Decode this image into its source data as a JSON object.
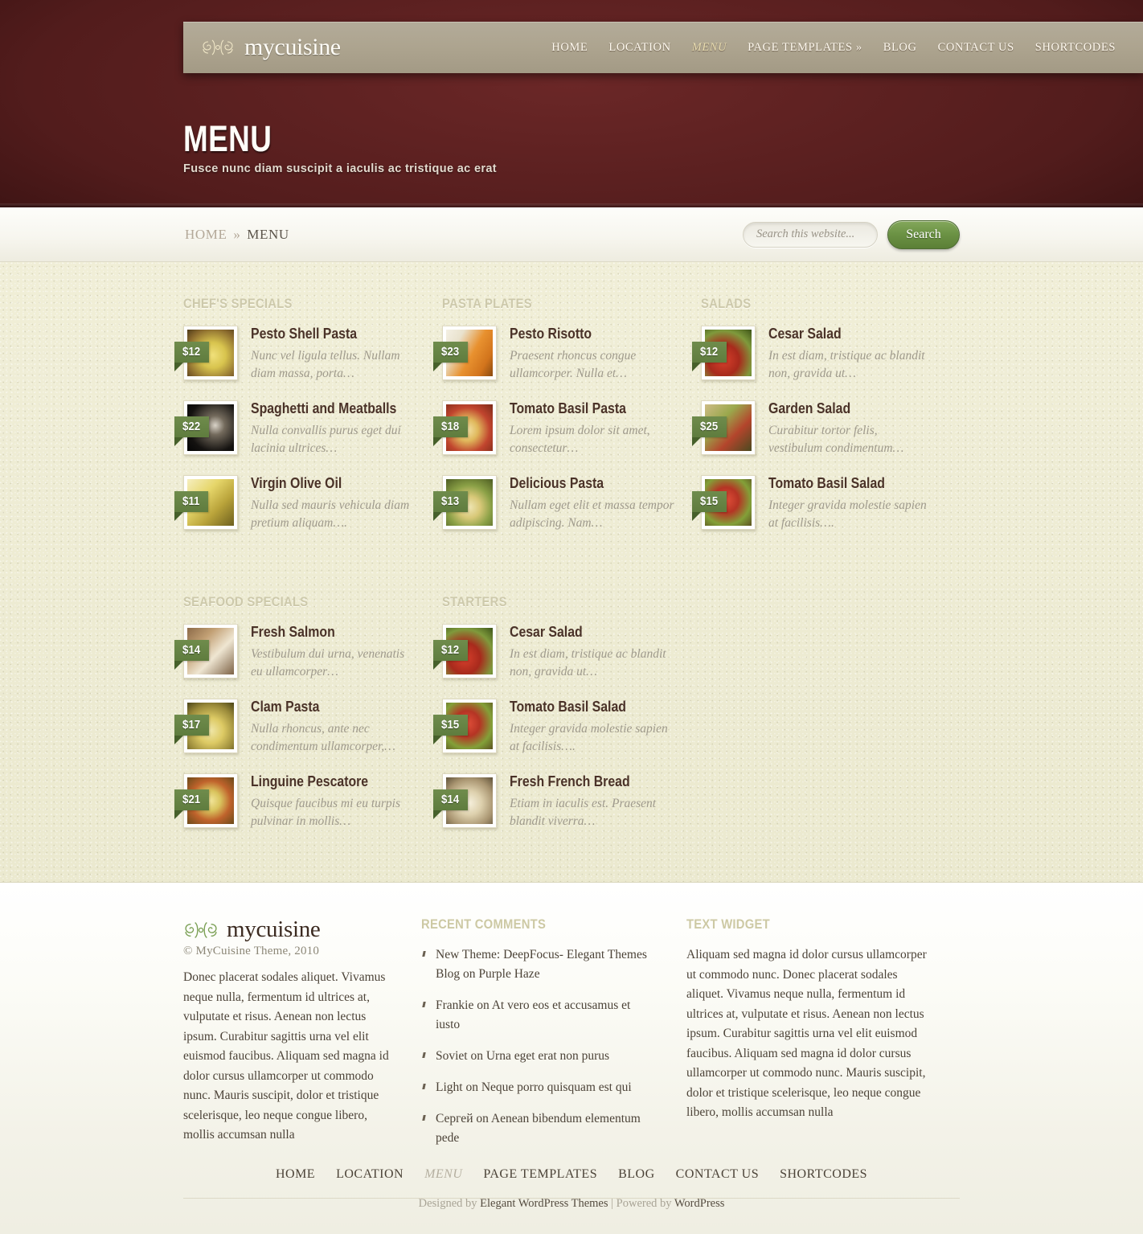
{
  "brand": {
    "name": "mycuisine",
    "flourish_icon": "ornamental-flourish-icon"
  },
  "nav": {
    "items": [
      {
        "label": "HOME",
        "active": false
      },
      {
        "label": "LOCATION",
        "active": false
      },
      {
        "label": "MENU",
        "active": true
      },
      {
        "label": "PAGE TEMPLATES »",
        "active": false
      },
      {
        "label": "BLOG",
        "active": false
      },
      {
        "label": "CONTACT US",
        "active": false
      },
      {
        "label": "SHORTCODES",
        "active": false
      }
    ]
  },
  "hero": {
    "title": "MENU",
    "subtitle": "Fusce nunc diam suscipit a iaculis ac tristique ac erat"
  },
  "breadcrumb": {
    "home": "HOME",
    "separator": "»",
    "current": "MENU"
  },
  "search": {
    "placeholder": "Search this website...",
    "value": "",
    "button": "Search"
  },
  "menu_sections": [
    {
      "title": "CHEF'S SPECIALS",
      "items": [
        {
          "price": "$12",
          "name": "Pesto Shell Pasta",
          "desc": "Nunc vel ligula tellus. Nullam diam massa, porta…",
          "photo": "ph-pestoshell"
        },
        {
          "price": "$22",
          "name": "Spaghetti and Meatballs",
          "desc": "Nulla convallis purus eget dui lacinia ultrices…",
          "photo": "ph-spaghetti"
        },
        {
          "price": "$11",
          "name": "Virgin Olive Oil",
          "desc": "Nulla sed mauris vehicula diam pretium aliquam….",
          "photo": "ph-oliveoil"
        }
      ]
    },
    {
      "title": "PASTA PLATES",
      "items": [
        {
          "price": "$23",
          "name": "Pesto Risotto",
          "desc": "Praesent rhoncus congue ullamcorper. Nulla et…",
          "photo": "ph-risotto"
        },
        {
          "price": "$18",
          "name": "Tomato Basil Pasta",
          "desc": "Lorem ipsum dolor sit amet, consectetur…",
          "photo": "ph-tomatopasta"
        },
        {
          "price": "$13",
          "name": "Delicious Pasta",
          "desc": "Nullam eget elit et massa tempor adipiscing. Nam…",
          "photo": "ph-delicious"
        }
      ]
    },
    {
      "title": "SALADS",
      "items": [
        {
          "price": "$12",
          "name": "Cesar Salad",
          "desc": "In est diam, tristique ac blandit non, gravida ut…",
          "photo": "ph-cesar"
        },
        {
          "price": "$25",
          "name": "Garden Salad",
          "desc": "Curabitur tortor felis, vestibulum condimentum…",
          "photo": "ph-garden"
        },
        {
          "price": "$15",
          "name": "Tomato Basil Salad",
          "desc": "Integer gravida molestie sapien at facilisis….",
          "photo": "ph-tomatobasil"
        }
      ]
    },
    {
      "title": "SEAFOOD SPECIALS",
      "items": [
        {
          "price": "$14",
          "name": "Fresh Salmon",
          "desc": "Vestibulum dui urna, venenatis eu ullamcorper…",
          "photo": "ph-salmon"
        },
        {
          "price": "$17",
          "name": "Clam Pasta",
          "desc": "Nulla rhoncus, ante nec condimentum ullamcorper,…",
          "photo": "ph-clam"
        },
        {
          "price": "$21",
          "name": "Linguine Pescatore",
          "desc": "Quisque faucibus mi eu turpis pulvinar in mollis…",
          "photo": "ph-linguine"
        }
      ]
    },
    {
      "title": "STARTERS",
      "items": [
        {
          "price": "$12",
          "name": "Cesar Salad",
          "desc": "In est diam, tristique ac blandit non, gravida ut…",
          "photo": "ph-cesar"
        },
        {
          "price": "$15",
          "name": "Tomato Basil Salad",
          "desc": "Integer gravida molestie sapien at facilisis….",
          "photo": "ph-tomatobasil"
        },
        {
          "price": "$14",
          "name": "Fresh French Bread",
          "desc": "Etiam in iaculis est. Praesent blandit viverra…",
          "photo": "ph-bread"
        }
      ]
    }
  ],
  "footer": {
    "brand": {
      "name": "mycuisine",
      "copyright": "© MyCuisine Theme, 2010"
    },
    "about_text": "Donec placerat sodales aliquet. Vivamus neque nulla, fermentum id ultrices at, vulputate et risus. Aenean non lectus ipsum. Curabitur sagittis urna vel elit euismod faucibus. Aliquam sed magna id dolor cursus ullamcorper ut commodo nunc. Mauris suscipit, dolor et tristique scelerisque, leo neque congue libero, mollis accumsan nulla",
    "recent_comments": {
      "title": "RECENT COMMENTS",
      "items": [
        "New Theme: DeepFocus- Elegant Themes Blog on Purple Haze",
        "Frankie on At vero eos et accusamus et iusto",
        "Soviet on Urna eget erat non purus",
        "Light on Neque porro quisquam est qui",
        "Сергей on Aenean bibendum elementum pede"
      ]
    },
    "text_widget": {
      "title": "TEXT WIDGET",
      "body": "Aliquam sed magna id dolor cursus ullamcorper ut commodo nunc. Donec placerat sodales aliquet. Vivamus neque nulla, fermentum id ultrices at, vulputate et risus. Aenean non lectus ipsum. Curabitur sagittis urna vel elit euismod faucibus. Aliquam sed magna id dolor cursus ullamcorper ut commodo nunc. Mauris suscipit, dolor et tristique scelerisque, leo neque congue libero, mollis accumsan nulla"
    },
    "nav": [
      {
        "label": "HOME",
        "active": false
      },
      {
        "label": "LOCATION",
        "active": false
      },
      {
        "label": "MENU",
        "active": true
      },
      {
        "label": "PAGE TEMPLATES",
        "active": false
      },
      {
        "label": "BLOG",
        "active": false
      },
      {
        "label": "CONTACT US",
        "active": false
      },
      {
        "label": "SHORTCODES",
        "active": false
      }
    ],
    "credits": {
      "prefix": "Designed by ",
      "designer": "Elegant WordPress Themes",
      "divider": " | ",
      "powered_prefix": "Powered by ",
      "platform": "WordPress"
    }
  },
  "colors": {
    "maroon": "#5c1f1f",
    "navbar": "#ada48f",
    "price_green": "#5f7c3e",
    "button_green": "#6c9345",
    "content_bg": "#eeecd3",
    "title_brown": "#4a3228"
  }
}
